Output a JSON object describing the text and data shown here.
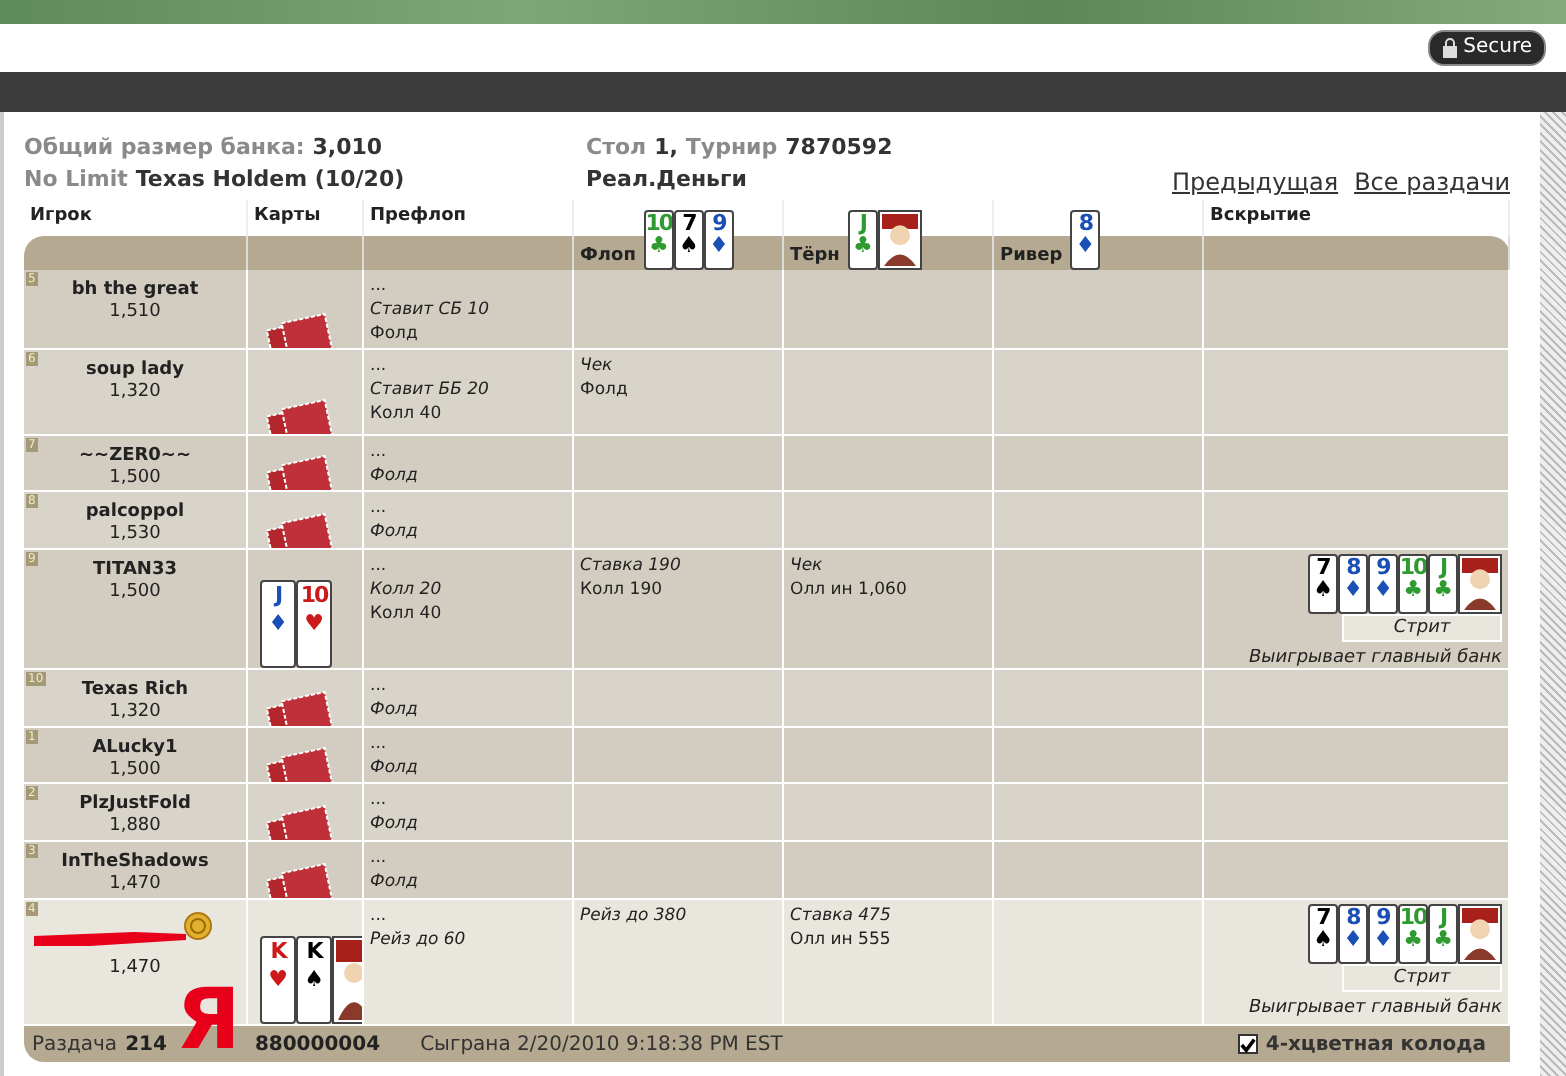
{
  "secure_button": {
    "label": "Secure"
  },
  "summary": {
    "pot": [
      {
        "text": "Общий размер банка:",
        "kind": "label"
      },
      {
        "text": "3,010",
        "kind": "value"
      }
    ],
    "game": [
      {
        "text": "No Limit",
        "kind": "label"
      },
      {
        "text": "Texas Holdem (10/20)",
        "kind": "value"
      }
    ],
    "table": [
      {
        "text": "Стол",
        "kind": "label"
      },
      {
        "text": "1,",
        "kind": "value"
      },
      {
        "text": "Турнир",
        "kind": "label"
      },
      {
        "text": "7870592",
        "kind": "value"
      }
    ],
    "money": [
      {
        "text": "Реал.Деньги",
        "kind": "value"
      }
    ]
  },
  "links": [
    "Предыдущая",
    "Все раздачи"
  ],
  "columns": [
    "Игрок",
    "Карты",
    "Префлоп",
    "Вскрытие"
  ],
  "streets": [
    {
      "label": "Флоп",
      "cards": [
        {
          "rank": "10",
          "suit": "♣",
          "color": "#2f9a2f",
          "face": false
        },
        {
          "rank": "7",
          "suit": "♠",
          "color": "#000000",
          "face": false
        },
        {
          "rank": "9",
          "suit": "♦",
          "color": "#1a4fb5",
          "face": false
        }
      ]
    },
    {
      "label": "Тёрн",
      "cards": [
        {
          "rank": "J",
          "suit": "♣",
          "color": "#2f9a2f",
          "face": true
        }
      ]
    },
    {
      "label": "Ривер",
      "cards": [
        {
          "rank": "8",
          "suit": "♦",
          "color": "#1a4fb5",
          "face": false
        }
      ]
    }
  ],
  "players": [
    {
      "seat": "5",
      "name": "bh the great",
      "stack": "1,510",
      "dealer": false,
      "redacted": false,
      "highlighted": false,
      "cards_hidden": true,
      "preflop": [
        {
          "text": "...",
          "italic": false
        },
        {
          "text": "Ставит СБ 10",
          "italic": true
        },
        {
          "text": "Фолд",
          "italic": false
        }
      ]
    },
    {
      "seat": "6",
      "name": "soup lady",
      "stack": "1,320",
      "dealer": false,
      "redacted": false,
      "highlighted": false,
      "cards_hidden": true,
      "preflop": [
        {
          "text": "...",
          "italic": false
        },
        {
          "text": "Ставит ББ 20",
          "italic": true
        },
        {
          "text": "Колл 40",
          "italic": false
        }
      ],
      "flop": [
        {
          "text": "Чек",
          "italic": true
        },
        {
          "text": "Фолд",
          "italic": false
        }
      ]
    },
    {
      "seat": "7",
      "name": "~~ZER0~~",
      "stack": "1,500",
      "dealer": false,
      "redacted": false,
      "highlighted": false,
      "cards_hidden": true,
      "preflop": [
        {
          "text": "...",
          "italic": false
        },
        {
          "text": "Фолд",
          "italic": true
        }
      ]
    },
    {
      "seat": "8",
      "name": "palcoppol",
      "stack": "1,530",
      "dealer": false,
      "redacted": false,
      "highlighted": false,
      "cards_hidden": true,
      "preflop": [
        {
          "text": "...",
          "italic": false
        },
        {
          "text": "Фолд",
          "italic": true
        }
      ]
    },
    {
      "seat": "9",
      "name": "TITAN33",
      "stack": "1,500",
      "dealer": false,
      "redacted": false,
      "highlighted": false,
      "cards_hidden": false,
      "cards": [
        {
          "rank": "J",
          "suit": "♦",
          "color": "#1a4fb5",
          "face": false
        },
        {
          "rank": "10",
          "suit": "♥",
          "color": "#cc1a1a",
          "face": false
        }
      ],
      "preflop": [
        {
          "text": "...",
          "italic": false
        },
        {
          "text": "Колл 20",
          "italic": true
        },
        {
          "text": "Колл 40",
          "italic": false
        }
      ],
      "flop": [
        {
          "text": "Ставка 190",
          "italic": true
        },
        {
          "text": "Колл 190",
          "italic": false
        }
      ],
      "turn": [
        {
          "text": "Чек",
          "italic": true
        },
        {
          "text": "Олл ин 1,060",
          "italic": false
        }
      ],
      "showdown": {
        "cards": [
          {
            "rank": "7",
            "suit": "♠",
            "color": "#000000",
            "face": false
          },
          {
            "rank": "8",
            "suit": "♦",
            "color": "#1a4fb5",
            "face": false
          },
          {
            "rank": "9",
            "suit": "♦",
            "color": "#1a4fb5",
            "face": false
          },
          {
            "rank": "10",
            "suit": "♣",
            "color": "#2f9a2f",
            "face": false
          },
          {
            "rank": "J",
            "suit": "♣",
            "color": "#2f9a2f",
            "face": true
          }
        ],
        "hand": "Стрит",
        "result": "Выигрывает главный банк"
      }
    },
    {
      "seat": "10",
      "name": "Texas Rich",
      "stack": "1,320",
      "dealer": false,
      "redacted": false,
      "highlighted": false,
      "cards_hidden": true,
      "preflop": [
        {
          "text": "...",
          "italic": false
        },
        {
          "text": "Фолд",
          "italic": true
        }
      ]
    },
    {
      "seat": "1",
      "name": "ALucky1",
      "stack": "1,500",
      "dealer": false,
      "redacted": false,
      "highlighted": false,
      "cards_hidden": true,
      "preflop": [
        {
          "text": "...",
          "italic": false
        },
        {
          "text": "Фолд",
          "italic": true
        }
      ]
    },
    {
      "seat": "2",
      "name": "PlzJustFold",
      "stack": "1,880",
      "dealer": false,
      "redacted": false,
      "highlighted": false,
      "cards_hidden": true,
      "preflop": [
        {
          "text": "...",
          "italic": false
        },
        {
          "text": "Фолд",
          "italic": true
        }
      ]
    },
    {
      "seat": "3",
      "name": "InTheShadows",
      "stack": "1,470",
      "dealer": false,
      "redacted": false,
      "highlighted": false,
      "cards_hidden": true,
      "preflop": [
        {
          "text": "...",
          "italic": false
        },
        {
          "text": "Фолд",
          "italic": true
        }
      ]
    },
    {
      "seat": "4",
      "stack": "1,470",
      "dealer": true,
      "redacted": true,
      "highlighted": true,
      "cards_hidden": false,
      "cards": [
        {
          "rank": "K",
          "suit": "♥",
          "color": "#cc1a1a",
          "face": false
        },
        {
          "rank": "K",
          "suit": "♠",
          "color": "#000000",
          "face": true
        }
      ],
      "preflop": [
        {
          "text": "...",
          "italic": false
        },
        {
          "text": "Рейз до 60",
          "italic": true
        }
      ],
      "flop": [
        {
          "text": "Рейз до 380",
          "italic": true
        }
      ],
      "turn": [
        {
          "text": "Ставка 475",
          "italic": true
        },
        {
          "text": "Олл ин 555",
          "italic": false
        }
      ],
      "showdown": {
        "cards": [
          {
            "rank": "7",
            "suit": "♠",
            "color": "#000000",
            "face": false
          },
          {
            "rank": "8",
            "suit": "♦",
            "color": "#1a4fb5",
            "face": false
          },
          {
            "rank": "9",
            "suit": "♦",
            "color": "#1a4fb5",
            "face": false
          },
          {
            "rank": "10",
            "suit": "♣",
            "color": "#2f9a2f",
            "face": false
          },
          {
            "rank": "J",
            "suit": "♣",
            "color": "#2f9a2f",
            "face": true
          }
        ],
        "hand": "Стрит",
        "result": "Выигрывает главный банк"
      }
    }
  ],
  "footer": {
    "hand_label": "Раздача",
    "hand_number_parts": [
      "214",
      "880000004"
    ],
    "played": "Сыграна 2/20/2010 9:18:38 PM EST",
    "four_color": {
      "label": "4-хцветная колода",
      "checked": true
    }
  },
  "annotation": {
    "letter": "Я"
  }
}
